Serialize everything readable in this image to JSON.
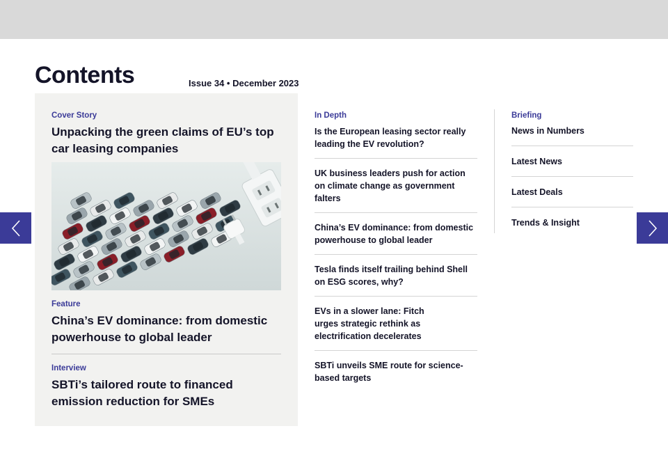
{
  "header": {
    "title": "Contents",
    "issue": "Issue 34 • December 2023"
  },
  "cover": {
    "kicker": "Cover Story",
    "title": "Unpacking the green claims of EU’s top car leasing companies",
    "image_icon": "cars-and-plug-image"
  },
  "feature": {
    "kicker": "Feature",
    "title": "China’s EV dominance: from domestic powerhouse to global leader"
  },
  "interview": {
    "kicker": "Interview",
    "title": "SBTi’s tailored route to financed emission reduction for SMEs"
  },
  "in_depth": {
    "kicker": "In Depth",
    "articles": [
      "Is the European leasing sector really leading the EV revolution?",
      "UK business leaders push for action on climate change as government falters",
      "China’s EV dominance: from domestic powerhouse to global leader",
      "Tesla finds itself trailing behind Shell on ESG scores, why?",
      "EVs in a slower lane: Fitch urges strategic rethink as electrification decelerates",
      "SBTi unveils SME route for science-based targets"
    ]
  },
  "briefing": {
    "kicker": "Briefing",
    "items": [
      "News in Numbers",
      "Latest News",
      "Latest Deals",
      "Trends & Insight"
    ]
  },
  "nav": {
    "prev_icon": "chevron-left-icon",
    "next_icon": "chevron-right-icon"
  },
  "colors": {
    "accent": "#3b3b98",
    "text": "#141428",
    "panel": "#f2f2f0",
    "topbar": "#d9d9d9"
  }
}
